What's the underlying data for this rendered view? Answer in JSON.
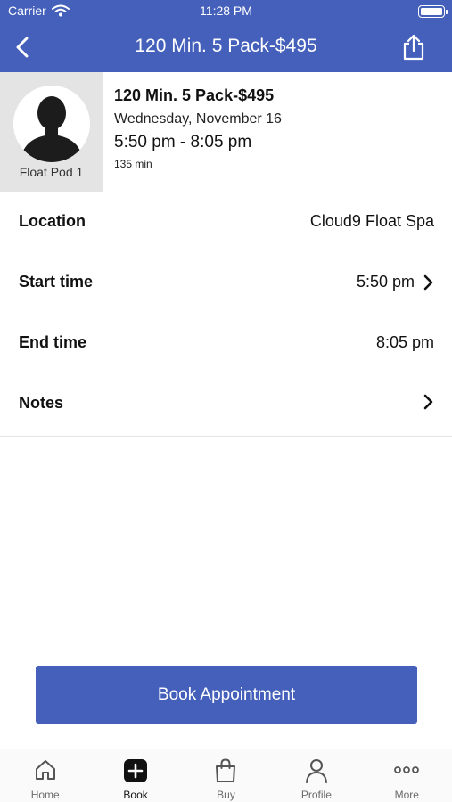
{
  "status_bar": {
    "carrier": "Carrier",
    "time": "11:28 PM"
  },
  "nav": {
    "title": "120 Min. 5 Pack-$495"
  },
  "header": {
    "pod_label": "Float Pod 1",
    "title": "120 Min. 5 Pack-$495",
    "date": "Wednesday, November 16",
    "time_range": "5:50 pm - 8:05 pm",
    "duration": "135 min"
  },
  "details": {
    "location_label": "Location",
    "location_value": "Cloud9 Float Spa",
    "start_label": "Start time",
    "start_value": "5:50 pm",
    "end_label": "End time",
    "end_value": "8:05 pm",
    "notes_label": "Notes"
  },
  "actions": {
    "book_label": "Book Appointment"
  },
  "tabs": [
    {
      "label": "Home",
      "icon": "home-icon"
    },
    {
      "label": "Book",
      "icon": "plus-square-icon"
    },
    {
      "label": "Buy",
      "icon": "shopping-bag-icon"
    },
    {
      "label": "Profile",
      "icon": "person-icon"
    },
    {
      "label": "More",
      "icon": "more-dots-icon"
    }
  ],
  "colors": {
    "brand": "#4560bb",
    "pod_background": "#e4e4e4"
  }
}
